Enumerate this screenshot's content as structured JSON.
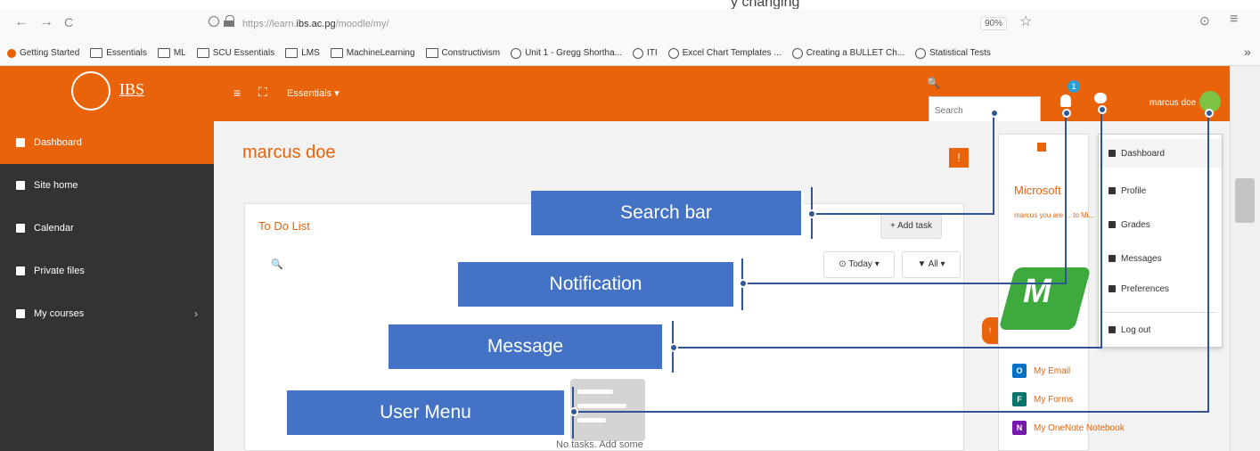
{
  "top_strip_text": "y changing",
  "browser": {
    "back_icon": "←",
    "forward_icon": "→",
    "reload_icon": "C",
    "url_prefix": "https://learn.",
    "url_domain": "ibs.ac.pg",
    "url_path": "/moodle/my/",
    "zoom": "90%",
    "bookmark_star_icon": "☆",
    "pocket_icon": "⊙",
    "menu_icon": "≡"
  },
  "bookmarks": [
    {
      "label": "Getting Started",
      "icon": "firefox"
    },
    {
      "label": "Essentials",
      "icon": "folder"
    },
    {
      "label": "ML",
      "icon": "folder"
    },
    {
      "label": "SCU Essentials",
      "icon": "folder"
    },
    {
      "label": "LMS",
      "icon": "folder"
    },
    {
      "label": "MachineLearning",
      "icon": "folder"
    },
    {
      "label": "Constructivism",
      "icon": "folder"
    },
    {
      "label": "Unit 1 - Gregg Shortha...",
      "icon": "globe"
    },
    {
      "label": "ITI",
      "icon": "globe"
    },
    {
      "label": "Excel Chart Templates ...",
      "icon": "globe"
    },
    {
      "label": "Creating a BULLET Ch...",
      "icon": "globe"
    },
    {
      "label": "Statistical Tests",
      "icon": "globe"
    }
  ],
  "bookmarks_overflow": "»",
  "header": {
    "logo_text": "IBS",
    "hamburger_icon": "≡",
    "expand_icon": "⛶",
    "essentials": "Essentials ▾",
    "search_icon": "🔍",
    "search_placeholder": "Search",
    "notification_count": "1",
    "username": "marcus doe"
  },
  "sidebar": [
    {
      "label": "Dashboard",
      "active": true
    },
    {
      "label": "Site home",
      "active": false
    },
    {
      "label": "Calendar",
      "active": false
    },
    {
      "label": "Private files",
      "active": false
    },
    {
      "label": "My courses",
      "active": false,
      "chevron": "›"
    }
  ],
  "main": {
    "page_title": "marcus doe",
    "orange_btn": "!",
    "todo_title": "To Do List",
    "add_task": "+ Add task",
    "search_icon": "🔍",
    "today": "⊙ Today ▾",
    "all": "▼ All ▾",
    "empty_text": "No tasks. Add some"
  },
  "right_panel": {
    "title": "Microsoft",
    "sub": "marcus you are ... to Mi...",
    "logo_text": "M",
    "side_tab": "!",
    "office": [
      {
        "label": "My Email",
        "icon": "O",
        "color": "#0072c6"
      },
      {
        "label": "My Forms",
        "icon": "F",
        "color": "#077568"
      },
      {
        "label": "My OneNote Notebook",
        "icon": "N",
        "color": "#7719aa"
      }
    ]
  },
  "user_menu": [
    {
      "label": "Dashboard"
    },
    {
      "label": "Profile"
    },
    {
      "label": "Grades"
    },
    {
      "label": "Messages"
    },
    {
      "label": "Preferences"
    },
    {
      "label": "Log out"
    }
  ],
  "callouts": {
    "search": "Search bar",
    "notification": "Notification",
    "message": "Message",
    "user_menu": "User Menu"
  },
  "colors": {
    "brand": "#e8630a",
    "sidebar": "#333333",
    "callout": "#4472c4"
  }
}
